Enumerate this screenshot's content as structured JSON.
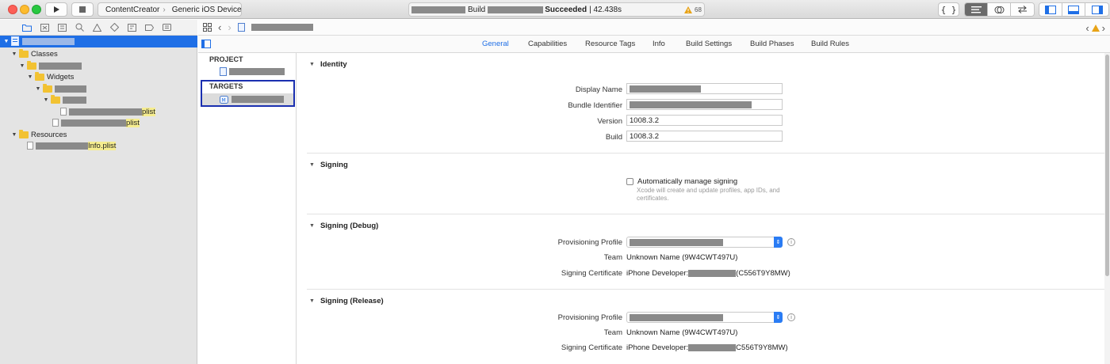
{
  "toolbar": {
    "scheme_name": "ContentCreator",
    "scheme_separator": "›",
    "device": "Generic iOS Device",
    "status_prefix": "Build",
    "status_result": "Succeeded",
    "status_time": "| 42.438s",
    "warning_count": "68"
  },
  "navigator": {
    "items": [
      {
        "label": "",
        "suffix": ""
      },
      {
        "label": "Classes",
        "suffix": ""
      },
      {
        "label": "",
        "suffix": ""
      },
      {
        "label": "Widgets",
        "suffix": ""
      },
      {
        "label": "",
        "suffix": ""
      },
      {
        "label": "",
        "suffix": ""
      },
      {
        "label": "",
        "suffix": "plist"
      },
      {
        "label": "",
        "suffix": "plist"
      },
      {
        "label": "Resources",
        "suffix": ""
      },
      {
        "label": "",
        "suffix": "Info.plist"
      }
    ]
  },
  "tabs": [
    "General",
    "Capabilities",
    "Resource Tags",
    "Info",
    "Build Settings",
    "Build Phases",
    "Build Rules"
  ],
  "targets_panel": {
    "project_heading": "PROJECT",
    "targets_heading": "TARGETS"
  },
  "sections": {
    "identity": {
      "title": "Identity",
      "display_name_label": "Display Name",
      "bundle_id_label": "Bundle Identifier",
      "version_label": "Version",
      "version_value": "1008.3.2",
      "build_label": "Build",
      "build_value": "1008.3.2"
    },
    "signing": {
      "title": "Signing",
      "auto_label": "Automatically manage signing",
      "auto_help": "Xcode will create and update profiles, app IDs, and certificates."
    },
    "signing_debug": {
      "title": "Signing (Debug)",
      "profile_label": "Provisioning Profile",
      "team_label": "Team",
      "team_value": "Unknown Name (9W4CWT497U)",
      "cert_label": "Signing Certificate",
      "cert_prefix": "iPhone Developer:",
      "cert_suffix": "(C556T9Y8MW)"
    },
    "signing_release": {
      "title": "Signing (Release)",
      "profile_label": "Provisioning Profile",
      "team_label": "Team",
      "team_value": "Unknown Name (9W4CWT497U)",
      "cert_label": "Signing Certificate",
      "cert_prefix": "iPhone Developer:",
      "cert_suffix": "C556T9Y8MW)"
    }
  },
  "colors": {
    "accent": "#1f6fe6",
    "warning": "#e8a317",
    "selection_border": "#1a2fb0"
  }
}
